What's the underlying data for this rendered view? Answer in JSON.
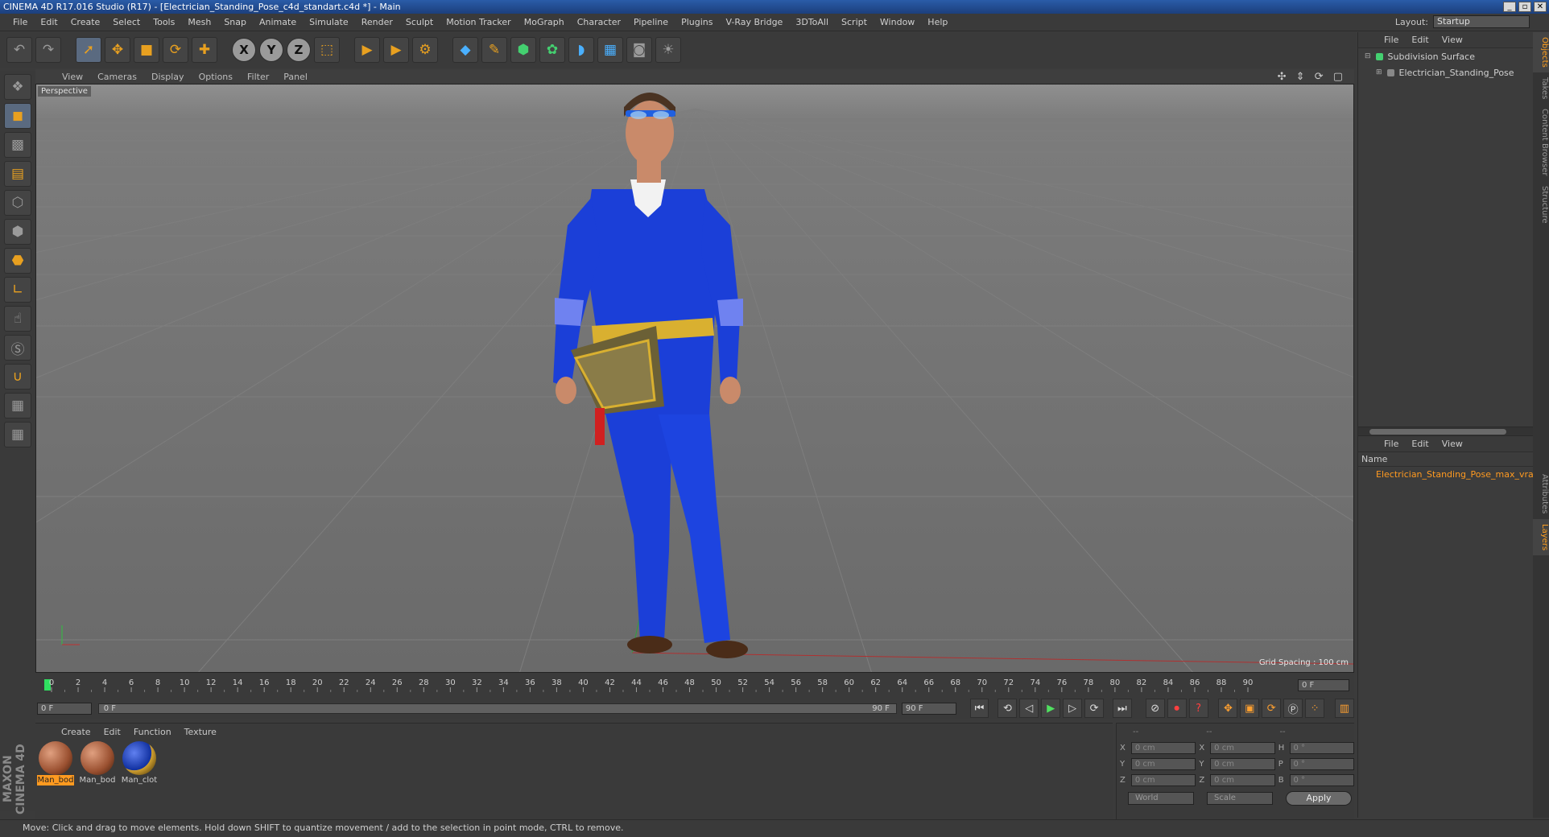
{
  "window": {
    "title": "CINEMA 4D R17.016 Studio (R17) - [Electrician_Standing_Pose_c4d_standart.c4d *] - Main",
    "controls": [
      "_",
      "▫",
      "✕"
    ]
  },
  "menubar": {
    "items": [
      "File",
      "Edit",
      "Create",
      "Select",
      "Tools",
      "Mesh",
      "Snap",
      "Animate",
      "Simulate",
      "Render",
      "Sculpt",
      "Motion Tracker",
      "MoGraph",
      "Character",
      "Pipeline",
      "Plugins",
      "V-Ray Bridge",
      "3DToAll",
      "Script",
      "Window",
      "Help"
    ],
    "layout_label": "Layout:",
    "layout_value": "Startup"
  },
  "toolbar": {
    "undo_icon": "undo-icon",
    "redo_icon": "redo-icon",
    "axis_x": "X",
    "axis_y": "Y",
    "axis_z": "Z"
  },
  "viewport": {
    "menu": [
      "View",
      "Cameras",
      "Display",
      "Options",
      "Filter",
      "Panel"
    ],
    "camera_label": "Perspective",
    "grid_spacing": "Grid Spacing : 100 cm",
    "nav_icons": "✣ ⇕ ⟳ ▢"
  },
  "timeline": {
    "ticks": [
      "0",
      "2",
      "4",
      "6",
      "8",
      "10",
      "12",
      "14",
      "16",
      "18",
      "20",
      "22",
      "24",
      "26",
      "28",
      "30",
      "32",
      "34",
      "36",
      "38",
      "40",
      "42",
      "44",
      "46",
      "48",
      "50",
      "52",
      "54",
      "56",
      "58",
      "60",
      "62",
      "64",
      "66",
      "68",
      "70",
      "72",
      "74",
      "76",
      "78",
      "80",
      "82",
      "84",
      "86",
      "88",
      "90"
    ],
    "current_frame": "0 F",
    "start_field": "0 F",
    "range_start": "0 F",
    "range_end": "90 F",
    "end_field": "90 F"
  },
  "materials": {
    "menu": [
      "Create",
      "Edit",
      "Function",
      "Texture"
    ],
    "items": [
      {
        "label": "Man_bod",
        "active": true
      },
      {
        "label": "Man_bod",
        "active": false
      },
      {
        "label": "Man_clot",
        "active": false
      }
    ],
    "brand": "MAXON CINEMA 4D"
  },
  "coordinates": {
    "headers": [
      "--",
      "--",
      "--"
    ],
    "rows": [
      {
        "a1": "X",
        "v1": "0 cm",
        "a2": "X",
        "v2": "0 cm",
        "a3": "H",
        "v3": "0 °"
      },
      {
        "a1": "Y",
        "v1": "0 cm",
        "a2": "Y",
        "v2": "0 cm",
        "a3": "P",
        "v3": "0 °"
      },
      {
        "a1": "Z",
        "v1": "0 cm",
        "a2": "Z",
        "v2": "0 cm",
        "a3": "B",
        "v3": "0 °"
      }
    ],
    "mode": "World",
    "scale": "Scale",
    "apply": "Apply"
  },
  "objects_panel": {
    "menu": [
      "File",
      "Edit",
      "View"
    ],
    "items": [
      {
        "label": "Subdivision Surface",
        "color": "#44d070"
      },
      {
        "label": "Electrician_Standing_Pose",
        "color": "#e8d020"
      }
    ]
  },
  "layers_panel": {
    "menu": [
      "File",
      "Edit",
      "View"
    ],
    "name_header": "Name",
    "items": [
      {
        "label": "Electrician_Standing_Pose_max_vray",
        "color": "#e8d020"
      }
    ]
  },
  "side_tabs": [
    "Objects",
    "Takes",
    "Content Browser",
    "Structure",
    "Attributes",
    "Layers"
  ],
  "status": {
    "text": "Move: Click and drag to move elements. Hold down SHIFT to quantize movement / add to the selection in point mode, CTRL to remove."
  },
  "colors": {
    "accent": "#ff9a20",
    "viewport_bg": "#6e6e6e",
    "panel_bg": "#3a3a3a",
    "suit_blue": "#1b3fd8"
  }
}
